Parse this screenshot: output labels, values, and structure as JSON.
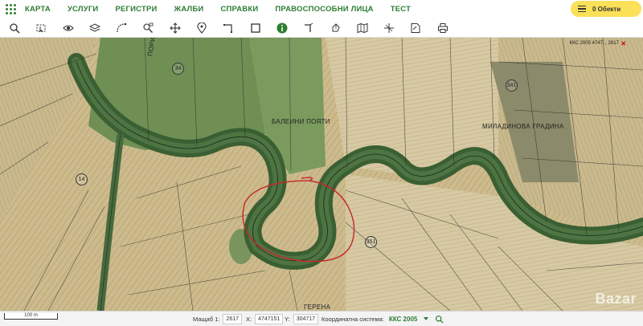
{
  "nav": {
    "items": [
      "КАРТА",
      "УСЛУГИ",
      "РЕГИСТРИ",
      "ЖАЛБИ",
      "СПРАВКИ",
      "ПРАВОСПОСОБНИ ЛИЦА",
      "ТЕСТ"
    ],
    "objects_button": "0 Обекти"
  },
  "toolbar": {
    "tools": [
      "search-icon",
      "select-icon",
      "eye-icon",
      "layers-icon",
      "measure-icon",
      "zoom-icon",
      "pan-icon",
      "pin-icon",
      "draw-polygon-icon",
      "rectangle-icon",
      "info-icon",
      "route-icon",
      "draw-icon",
      "map-icon",
      "crosshair-icon",
      "note-icon",
      "print-icon"
    ],
    "active": "info-icon"
  },
  "map": {
    "labels": [
      "БАЛЕИНИ ПОЯТИ",
      "МИЛАДИНОВА ГРАДИНА",
      "ГЕРЕНА",
      "ПОРИ..."
    ],
    "parcels": [
      "34",
      "14",
      "341",
      "351"
    ],
    "crs_badge": "ККС 2005 4747... 2617",
    "watermark": "Bazar"
  },
  "status": {
    "scale_bar": "100 m",
    "scale_label": "Мащаб 1:",
    "scale_value": "2617",
    "x_label": "X:",
    "x_value": "4747151",
    "y_label": "Y:",
    "y_value": "304717",
    "crs_label": "Координатна система:",
    "crs_value": "ККС 2005"
  },
  "colors": {
    "accent": "#2e7d32",
    "objects_button": "#fbe05a",
    "annotation_circle": "#c62828"
  }
}
